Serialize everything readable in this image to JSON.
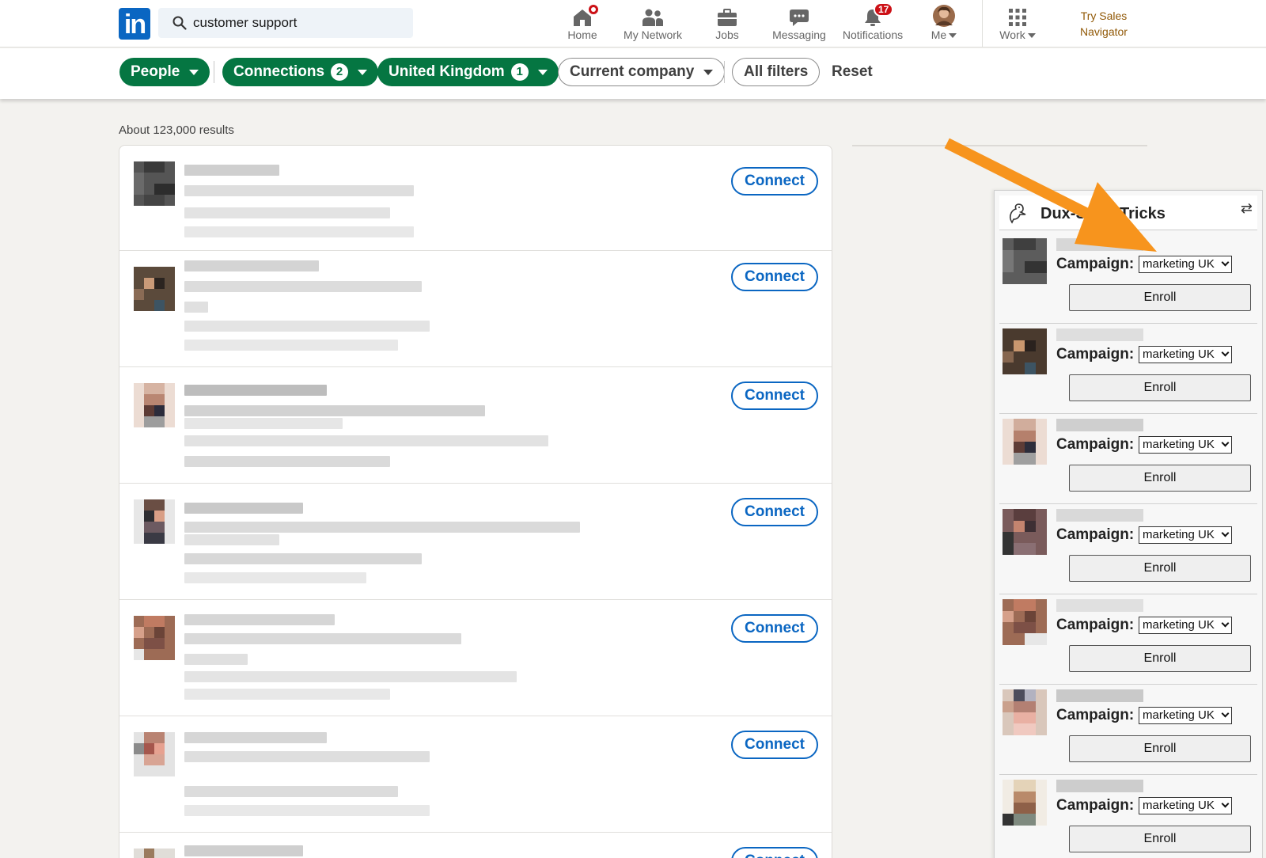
{
  "search": {
    "value": "customer support"
  },
  "nav": {
    "items": [
      {
        "label": "Home",
        "icon": "home-icon"
      },
      {
        "label": "My Network",
        "icon": "network-icon"
      },
      {
        "label": "Jobs",
        "icon": "briefcase-icon"
      },
      {
        "label": "Messaging",
        "icon": "messaging-icon"
      },
      {
        "label": "Notifications",
        "icon": "bell-icon",
        "badge": "17"
      },
      {
        "label": "Me",
        "icon": "avatar"
      },
      {
        "label": "Work",
        "icon": "grid-icon"
      }
    ],
    "sales_line1": "Try Sales",
    "sales_line2": "Navigator"
  },
  "filters": {
    "people": "People",
    "connections": "Connections",
    "connections_count": "2",
    "location": "United Kingdom",
    "location_count": "1",
    "company": "Current company",
    "all": "All filters",
    "reset": "Reset"
  },
  "results": {
    "count": "About 123,000 results",
    "connect_label": "Connect"
  },
  "panel": {
    "title": "Dux-Soup Tricks",
    "campaign_label": "Campaign:",
    "campaign_value": "marketing UK",
    "enroll_label": "Enroll"
  },
  "colors": {
    "brand": "#0a66c2",
    "filter_active": "#057642",
    "badge": "#cc1016",
    "annotation_arrow": "#f7941d"
  }
}
